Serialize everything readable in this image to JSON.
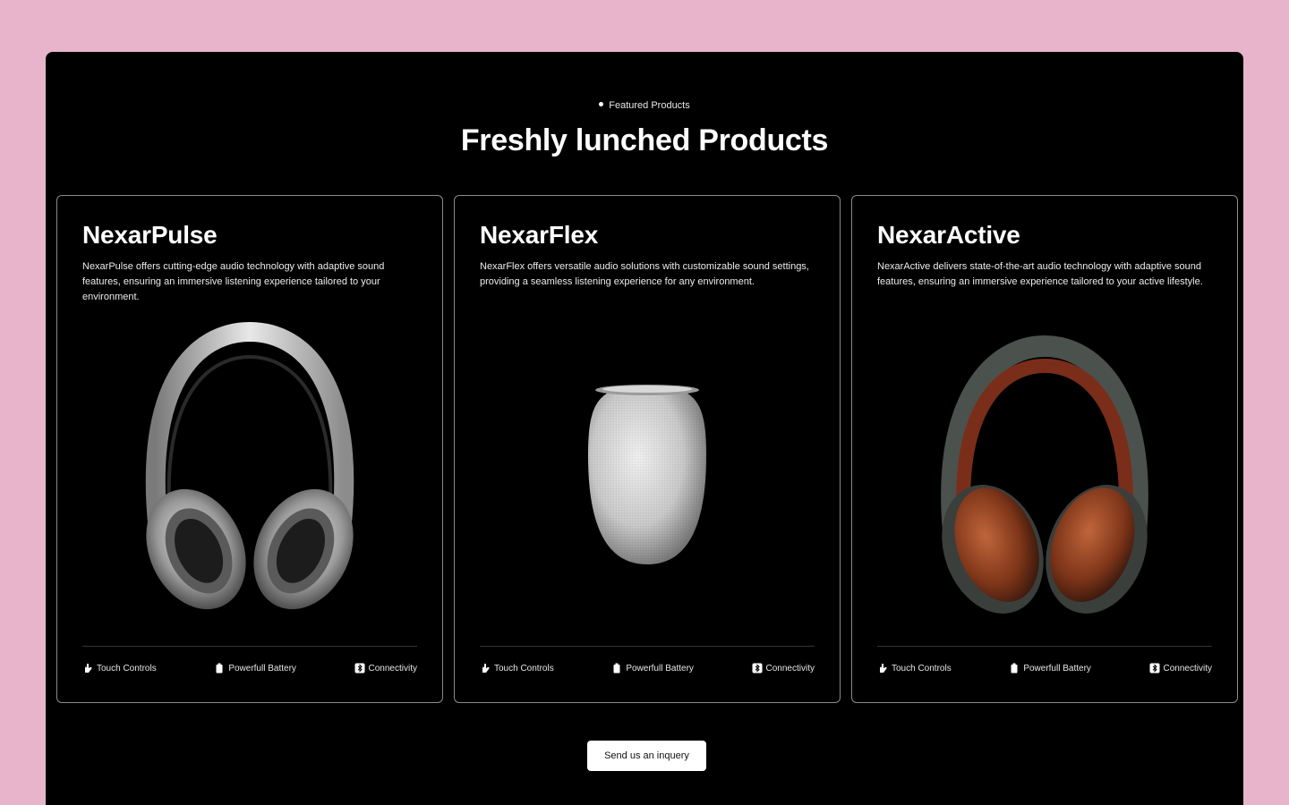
{
  "section": {
    "eyebrow": "Featured Products",
    "title": "Freshly lunched Products"
  },
  "products": [
    {
      "name": "NexarPulse",
      "description": "NexarPulse offers cutting-edge audio technology with adaptive sound features, ensuring an immersive listening experience tailored to your environment.",
      "image": "silver-headphones",
      "features": [
        "Touch Controls",
        "Powerfull Battery",
        "Connectivity"
      ]
    },
    {
      "name": "NexarFlex",
      "description": "NexarFlex offers versatile audio solutions with customizable sound settings, providing a seamless listening experience for any environment.",
      "image": "white-smart-speaker",
      "features": [
        "Touch Controls",
        "Powerfull Battery",
        "Connectivity"
      ]
    },
    {
      "name": "NexarActive",
      "description": "NexarActive delivers state-of-the-art audio technology with adaptive sound features, ensuring an immersive experience tailored to your active lifestyle.",
      "image": "brown-leather-headphones",
      "features": [
        "Touch Controls",
        "Powerfull Battery",
        "Connectivity"
      ]
    }
  ],
  "feature_icons": [
    "touch-icon",
    "battery-icon",
    "bluetooth-icon"
  ],
  "cta": {
    "label": "Send us an inquery"
  },
  "colors": {
    "page_background": "#e8b4cb",
    "panel_background": "#000000",
    "card_border": "#8a8a8a",
    "text": "#ffffff",
    "cta_background": "#ffffff"
  }
}
